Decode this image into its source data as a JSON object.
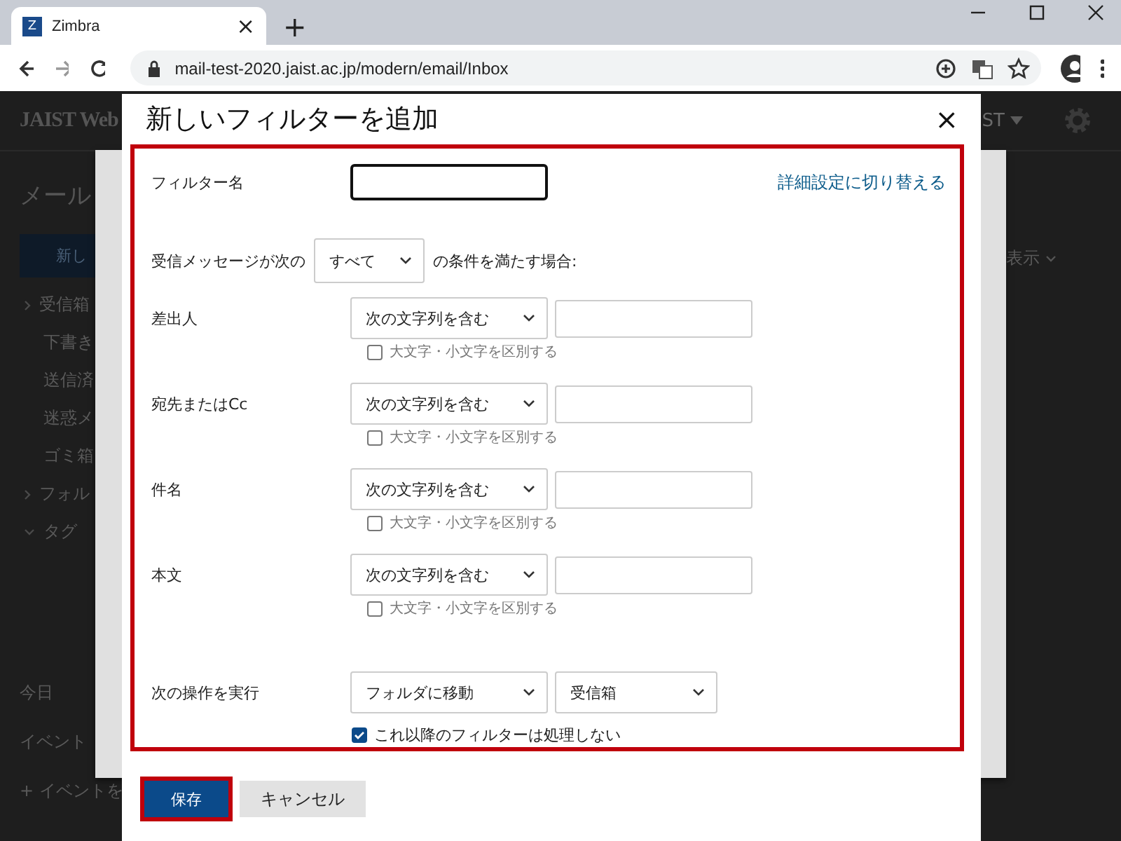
{
  "browser": {
    "tab_icon": "Z",
    "tab_title": "Zimbra",
    "tab_close": "×",
    "new_tab": "+",
    "url": "mail-test-2020.jaist.ac.jp/modern/email/Inbox"
  },
  "app": {
    "logo": "JAIST Web",
    "user": "ST",
    "section": "メール",
    "new_button": "新し",
    "folders": [
      {
        "label": "受信箱",
        "expandable": true
      },
      {
        "label": "下書き",
        "expandable": false
      },
      {
        "label": "送信済",
        "expandable": false
      },
      {
        "label": "迷惑メ",
        "expandable": false
      },
      {
        "label": "ゴミ箱",
        "expandable": false
      },
      {
        "label": "フォル",
        "expandable": true
      }
    ],
    "tags": "タグ",
    "view": "表示",
    "calendar_today": "今日",
    "no_events": "イベント",
    "add_event": "+ イベントを"
  },
  "dialog": {
    "title": "新しいフィルターを追加",
    "close": "×",
    "highlighted": true,
    "name_label": "フィルター名",
    "advanced_link": "詳細設定に切り替える",
    "match_prefix": "受信メッセージが次の",
    "match_select": "すべて",
    "match_suffix": "の条件を満たす場合:",
    "conditions": [
      {
        "label": "差出人",
        "operator": "次の文字列を含む",
        "case_label": "大文字・小文字を区別する",
        "case_checked": false
      },
      {
        "label": "宛先またはCc",
        "operator": "次の文字列を含む",
        "case_label": "大文字・小文字を区別する",
        "case_checked": false
      },
      {
        "label": "件名",
        "operator": "次の文字列を含む",
        "case_label": "大文字・小文字を区別する",
        "case_checked": false
      },
      {
        "label": "本文",
        "operator": "次の文字列を含む",
        "case_label": "大文字・小文字を区別する",
        "case_checked": false
      }
    ],
    "action": {
      "label": "次の操作を実行",
      "operation": "フォルダに移動",
      "folder": "受信箱",
      "stop_label": "これ以降のフィルターは処理しない",
      "stop_checked": true
    },
    "buttons": [
      {
        "label": "保存",
        "kind": "primary",
        "highlighted": true
      },
      {
        "label": "キャンセル",
        "kind": "secondary",
        "highlighted": false
      }
    ]
  }
}
